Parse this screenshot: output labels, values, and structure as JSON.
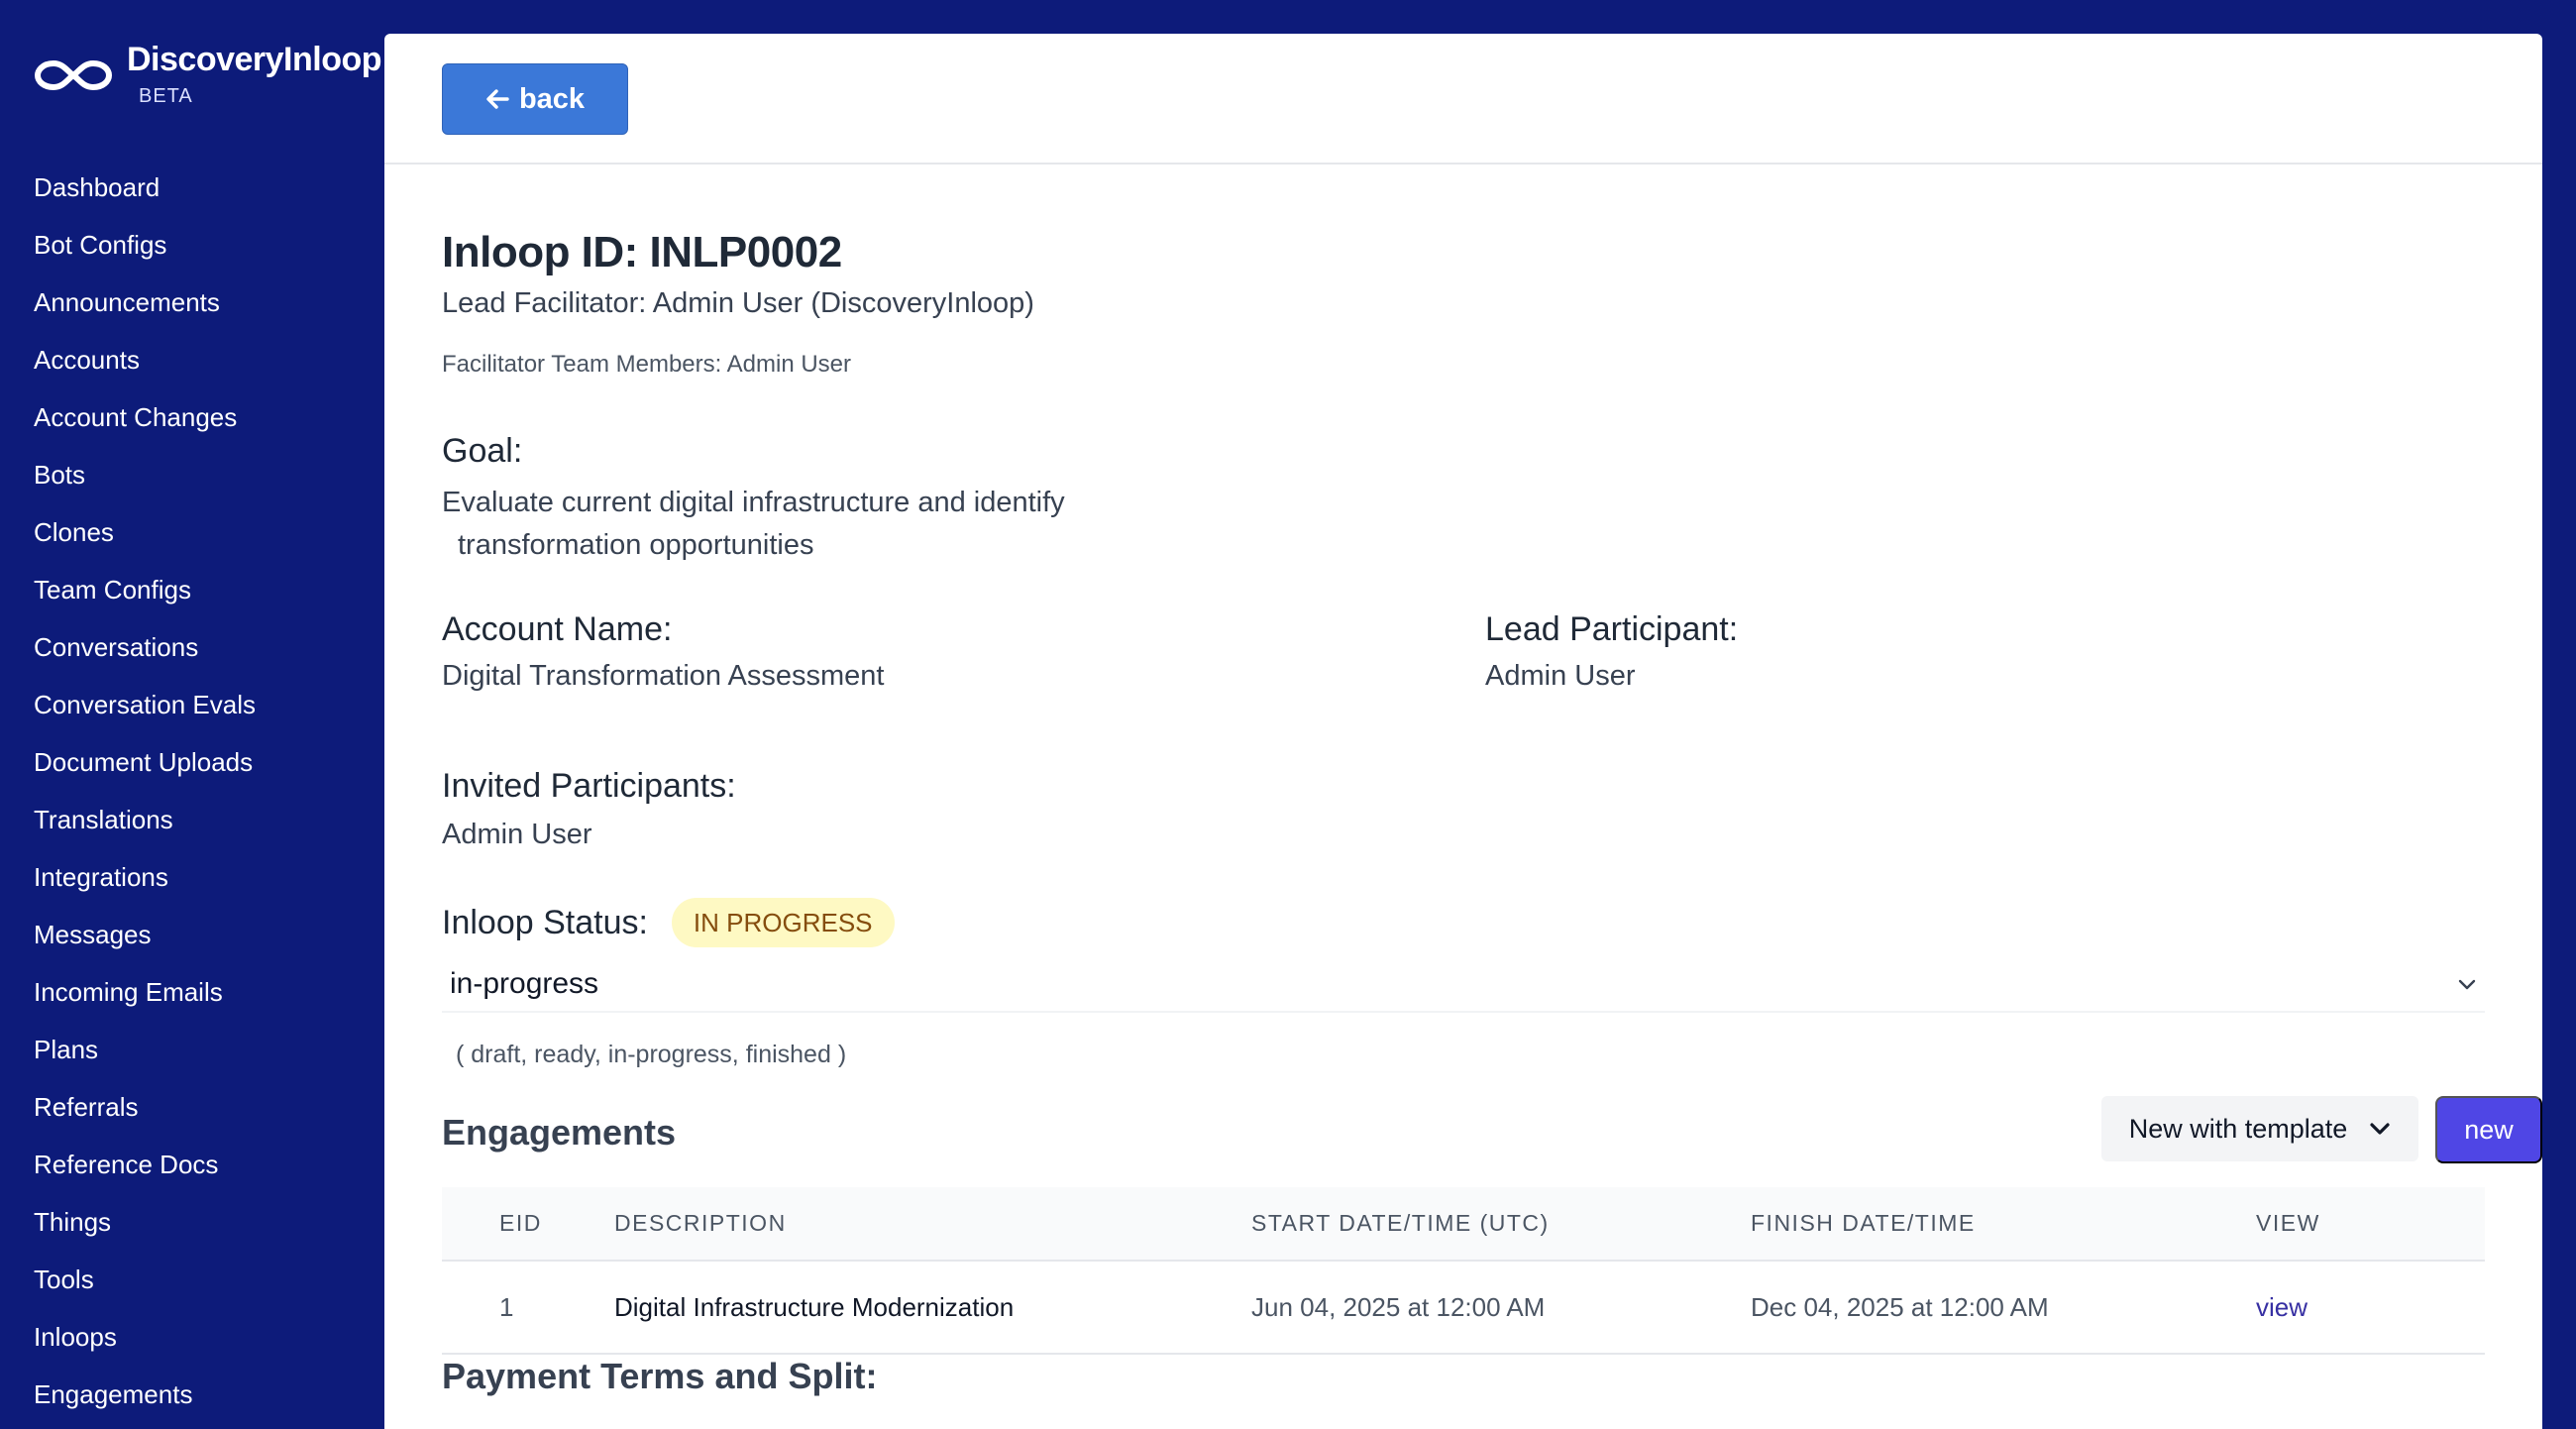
{
  "brand": {
    "name": "DiscoveryInloop",
    "badge": "BETA",
    "logo_icon": "infinity-logo-icon"
  },
  "sidebar": {
    "items": [
      {
        "label": "Dashboard"
      },
      {
        "label": "Bot Configs"
      },
      {
        "label": "Announcements"
      },
      {
        "label": "Accounts"
      },
      {
        "label": "Account Changes"
      },
      {
        "label": "Bots"
      },
      {
        "label": "Clones"
      },
      {
        "label": "Team Configs"
      },
      {
        "label": "Conversations"
      },
      {
        "label": "Conversation Evals"
      },
      {
        "label": "Document Uploads"
      },
      {
        "label": "Translations"
      },
      {
        "label": "Integrations"
      },
      {
        "label": "Messages"
      },
      {
        "label": "Incoming Emails"
      },
      {
        "label": "Plans"
      },
      {
        "label": "Referrals"
      },
      {
        "label": "Reference Docs"
      },
      {
        "label": "Things"
      },
      {
        "label": "Tools"
      },
      {
        "label": "Inloops"
      },
      {
        "label": "Engagements"
      }
    ]
  },
  "toolbar": {
    "back_label": "back",
    "back_icon": "arrow-left-icon"
  },
  "inloop": {
    "id_line": "Inloop ID: INLP0002",
    "lead_facilitator": "Lead Facilitator: Admin User (DiscoveryInloop)",
    "team_members": "Facilitator Team Members: Admin User",
    "goal_label": "Goal:",
    "goal_line1": "Evaluate current digital infrastructure and identify",
    "goal_line2": "transformation opportunities",
    "account_label": "Account Name:",
    "account_value": "Digital Transformation Assessment",
    "lead_participant_label": "Lead Participant:",
    "lead_participant_value": "Admin User",
    "invited_label": "Invited Participants:",
    "invited_value": "Admin User",
    "status_label": "Inloop Status:",
    "status_badge": "IN PROGRESS",
    "status_select_value": "in-progress",
    "status_options_hint": "( draft, ready, in-progress, finished )"
  },
  "engagements": {
    "title": "Engagements",
    "template_button": "New with template",
    "new_button": "new",
    "columns": [
      "EID",
      "DESCRIPTION",
      "START DATE/TIME (UTC)",
      "FINISH DATE/TIME",
      "VIEW"
    ],
    "rows": [
      {
        "eid": "1",
        "description": "Digital Infrastructure Modernization",
        "start": "Jun 04, 2025 at 12:00 AM",
        "finish": "Dec 04, 2025 at 12:00 AM",
        "view": "view"
      }
    ]
  },
  "payment": {
    "title": "Payment Terms and Split:"
  },
  "colors": {
    "sidebar_bg": "#0d1b7a",
    "back_button": "#3b78d8",
    "new_button": "#4f46e5",
    "status_badge_bg": "#fef9c3",
    "status_badge_text": "#854d0e",
    "link": "#3730a3"
  }
}
